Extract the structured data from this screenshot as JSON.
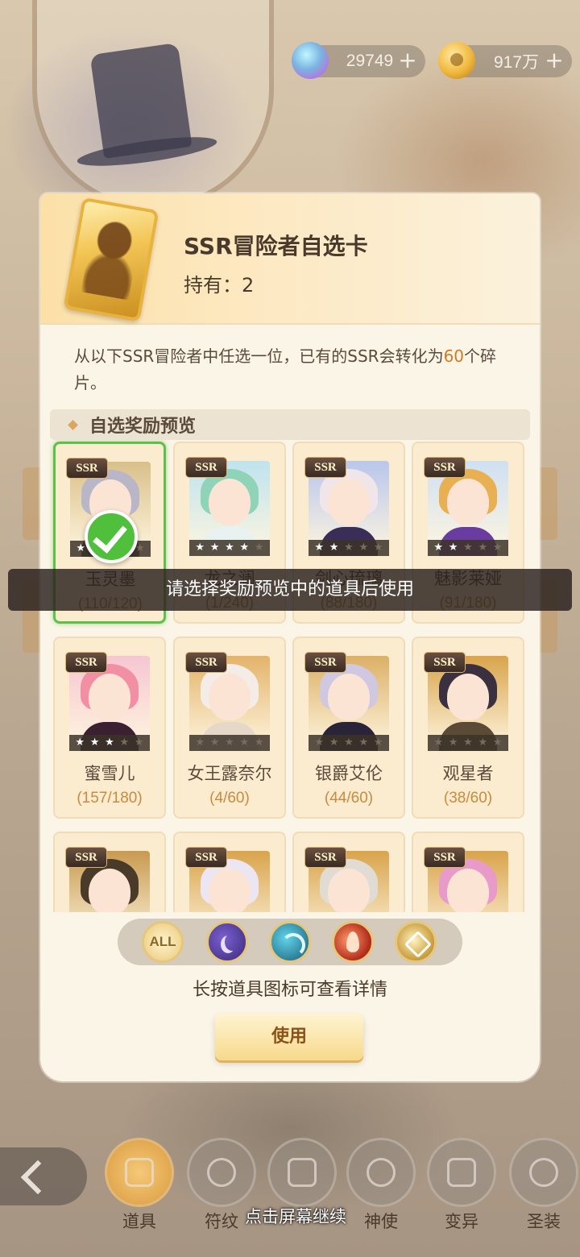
{
  "currency": {
    "gems": "29749",
    "gold": "917万",
    "plus": "+"
  },
  "dialog": {
    "title": "SSR冒险者自选卡",
    "owned": "持有：2",
    "description_before": "从以下SSR冒险者中任选一位，已有的SSR会转化为",
    "description_amount": "60",
    "description_after": "个碎片。",
    "section_title": "自选奖励预览",
    "ssr_tag": "SSR",
    "hint": "长按道具图标可查看详情",
    "use_button": "使用",
    "filter_all": "ALL"
  },
  "characters": [
    {
      "name": "玉灵墨",
      "progress": "(110/120)",
      "stars": 4,
      "selected": true,
      "hair": "#b9b6c8",
      "body": "#4a4258",
      "bg": "#d9c08a"
    },
    {
      "name": "龙之澜",
      "progress": "(1/240)",
      "stars": 4,
      "selected": false,
      "hair": "#8fd3b8",
      "body": "#e8f2f0",
      "bg": "#bfe3ee"
    },
    {
      "name": "剑心琉璃",
      "progress": "(88/180)",
      "stars": 2,
      "selected": false,
      "hair": "#f0e6ea",
      "body": "#3a2e58",
      "bg": "#b9c6ec"
    },
    {
      "name": "魅影莱娅",
      "progress": "(91/180)",
      "stars": 2,
      "selected": false,
      "hair": "#e8b052",
      "body": "#6a3ca0",
      "bg": "#cfe0f2"
    },
    {
      "name": "蜜雪儿",
      "progress": "(157/180)",
      "stars": 3,
      "selected": false,
      "hair": "#f28fa4",
      "body": "#3a2030",
      "bg": "#f6c6d2"
    },
    {
      "name": "女王露奈尔",
      "progress": "(4/60)",
      "stars": 0,
      "selected": false,
      "hair": "#f4ece6",
      "body": "#e6d8c8",
      "bg": "#e3b36a"
    },
    {
      "name": "银爵艾伦",
      "progress": "(44/60)",
      "stars": 0,
      "selected": false,
      "hair": "#cfc8e0",
      "body": "#2a2438",
      "bg": "#dcb066"
    },
    {
      "name": "观星者",
      "progress": "(38/60)",
      "stars": 0,
      "selected": false,
      "hair": "#3a3040",
      "body": "#5a4a36",
      "bg": "#d9a44c"
    },
    {
      "name": "",
      "progress": "",
      "stars": 0,
      "selected": false,
      "hair": "#4a3a2a",
      "body": "#2a2a20",
      "bg": "#c89a50"
    },
    {
      "name": "",
      "progress": "",
      "stars": 0,
      "selected": false,
      "hair": "#ece6f2",
      "body": "#3a3040",
      "bg": "#d9a44c"
    },
    {
      "name": "",
      "progress": "",
      "stars": 0,
      "selected": false,
      "hair": "#e0dcd4",
      "body": "#5a4a3a",
      "bg": "#d9a44c"
    },
    {
      "name": "",
      "progress": "",
      "stars": 0,
      "selected": false,
      "hair": "#e89ac8",
      "body": "#2a8c9a",
      "bg": "#d9a44c"
    }
  ],
  "toast": "请选择奖励预览中的道具后使用",
  "nav": [
    {
      "label": "道具",
      "icon": "bag-icon",
      "active": true
    },
    {
      "label": "符纹",
      "icon": "rune-icon",
      "active": false
    },
    {
      "label": "",
      "icon": "cards-icon",
      "active": false
    },
    {
      "label": "神使",
      "icon": "envoy-icon",
      "active": false
    },
    {
      "label": "变异",
      "icon": "mutation-icon",
      "active": false
    },
    {
      "label": "圣装",
      "icon": "holy-gear-icon",
      "active": false
    }
  ],
  "continue_text": "点击屏幕继续",
  "colors": {
    "accent_orange": "#d27a22",
    "selected_green": "#5ec04a",
    "panel_bg": "#fbf5e7"
  }
}
